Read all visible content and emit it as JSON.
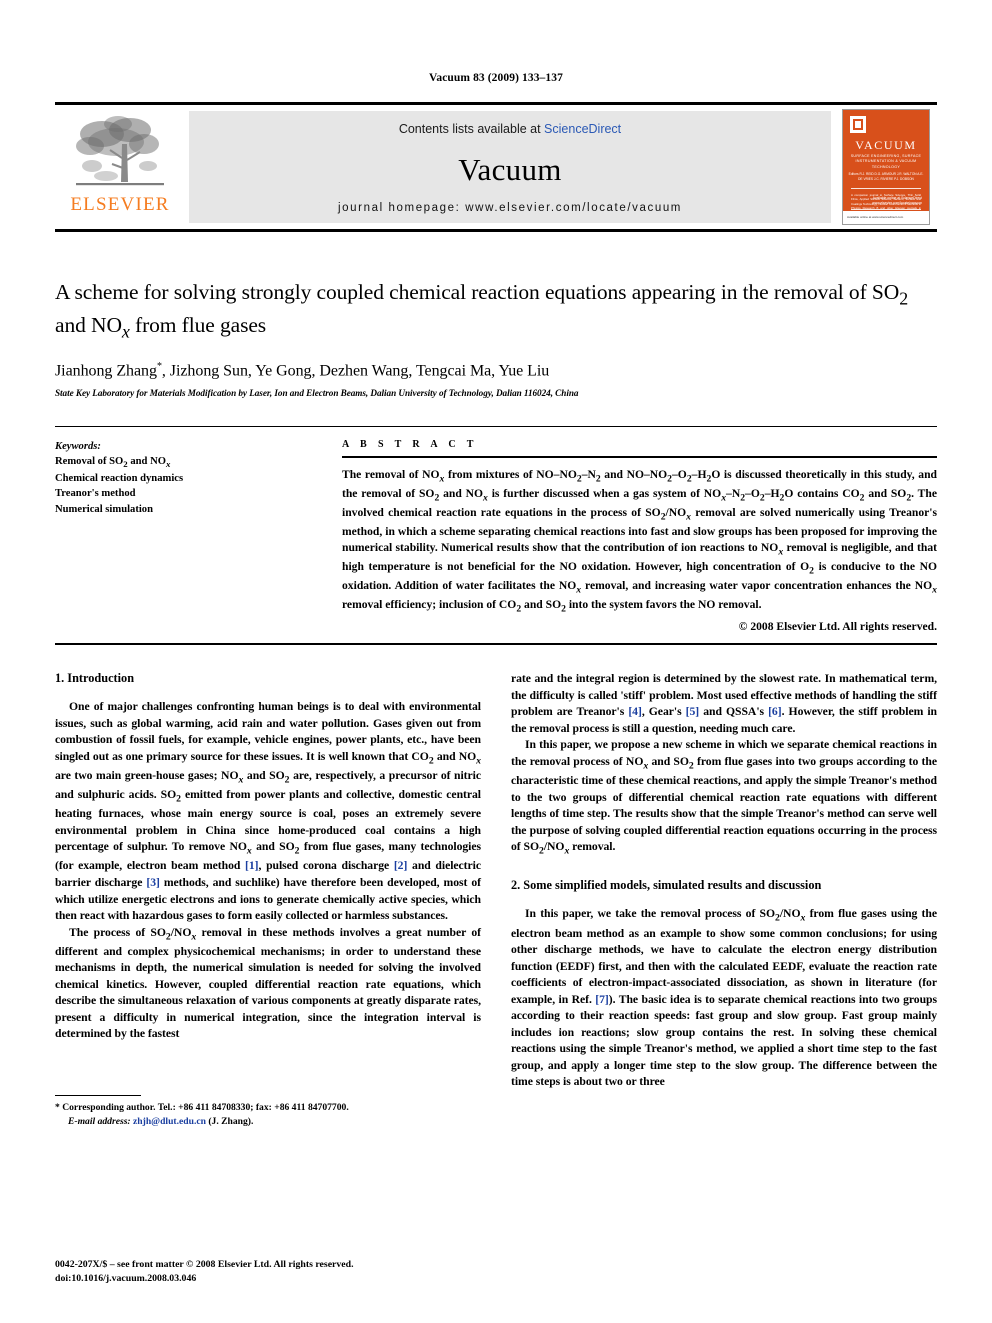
{
  "running_head": "Vacuum 83 (2009) 133–137",
  "masthead": {
    "contents_prefix": "Contents lists available at ",
    "sciencedirect": "ScienceDirect",
    "journal_name": "Vacuum",
    "homepage": "journal homepage: www.elsevier.com/locate/vacuum",
    "publisher_logo_text": "ELSEVIER",
    "accent_orange": "#F57C20",
    "sciencedirect_blue": "#2b59b5",
    "band_gray": "#e6e6e6"
  },
  "cover": {
    "title": "VACUUM",
    "subtitle": "SURFACE ENGINEERING, SURFACE INSTRUMENTATION & VACUUM TECHNOLOGY",
    "editors": "Editors\nR.J. REID   D.G. ARMOUR   J.R. WALTON\nA.E. DE VRIES   J.C. RIVIERE   P.J. DOBSON",
    "blurb": "A companion journal to Surface Science, Thin Solid Films, Applied Surface Science, Vacuum, Surface and Coatings Technology, Nuclear Instruments & Methods in Physics Research B and other Elsevier journals in materials science",
    "footer_left": "Available online at www.sciencedirect.com",
    "sciencedirect": "Available online at\nScienceDirect\nwww.elsevier.com/locate/vacuum",
    "cover_color": "#D8501B"
  },
  "article": {
    "title": "A scheme for solving strongly coupled chemical reaction equations appearing in the removal of SO₂ and NO𝑥 from flue gases",
    "title_line1_pre": "A scheme for solving strongly coupled chemical reaction equations",
    "authors": "Jianhong Zhang, Jizhong Sun, Ye Gong, Dezhen Wang, Tengcai Ma, Yue Liu",
    "corresponding_marker": "*",
    "affiliation": "State Key Laboratory for Materials Modification by Laser, Ion and Electron Beams, Dalian University of Technology, Dalian 116024, China"
  },
  "keywords": {
    "label": "Keywords:",
    "items": [
      "Removal of SO₂ and NO𝑥",
      "Chemical reaction dynamics",
      "Treanor's method",
      "Numerical simulation"
    ]
  },
  "abstract": {
    "label": "A B S T R A C T",
    "text": "The removal of NO𝑥 from mixtures of NO–NO₂–N₂ and NO–NO₂–O₂–H₂O is discussed theoretically in this study, and the removal of SO₂ and NO𝑥 is further discussed when a gas system of NO𝑥–N₂–O₂–H₂O contains CO₂ and SO₂. The involved chemical reaction rate equations in the process of SO₂/NO𝑥 removal are solved numerically using Treanor's method, in which a scheme separating chemical reactions into fast and slow groups has been proposed for improving the numerical stability. Numerical results show that the contribution of ion reactions to NO𝑥 removal is negligible, and that high temperature is not beneficial for the NO oxidation. However, high concentration of O₂ is conducive to the NO oxidation. Addition of water facilitates the NO𝑥 removal, and increasing water vapor concentration enhances the NO𝑥 removal efficiency; inclusion of CO₂ and SO₂ into the system favors the NO removal.",
    "copyright": "© 2008 Elsevier Ltd. All rights reserved."
  },
  "sections": {
    "intro_heading": "1. Introduction",
    "intro_p1": "One of major challenges confronting human beings is to deal with environmental issues, such as global warming, acid rain and water pollution. Gases given out from combustion of fossil fuels, for example, vehicle engines, power plants, etc., have been singled out as one primary source for these issues. It is well known that CO₂ and NO𝑥 are two main green-house gases; NO𝑥 and SO₂ are, respectively, a precursor of nitric and sulphuric acids. SO₂ emitted from power plants and collective, domestic central heating furnaces, whose main energy source is coal, poses an extremely severe environmental problem in China since home-produced coal contains a high percentage of sulphur. To remove NO𝑥 and SO₂ from flue gases, many technologies (for example, electron beam method [1], pulsed corona discharge [2] and dielectric barrier discharge [3] methods, and suchlike) have therefore been developed, most of which utilize energetic electrons and ions to generate chemically active species, which then react with hazardous gases to form easily collected or harmless substances.",
    "intro_p2": "The process of SO₂/NO𝑥 removal in these methods involves a great number of different and complex physicochemical mechanisms; in order to understand these mechanisms in depth, the numerical simulation is needed for solving the involved chemical kinetics. However, coupled differential reaction rate equations, which describe the simultaneous relaxation of various components at greatly disparate rates, present a difficulty in numerical integration, since the integration interval is determined by the fastest",
    "intro_p2_cont": "rate and the integral region is determined by the slowest rate. In mathematical term, the difficulty is called 'stiff' problem. Most used effective methods of handling the stiff problem are Treanor's [4], Gear's [5] and QSSA's [6]. However, the stiff problem in the removal process is still a question, needing much care.",
    "intro_p3": "In this paper, we propose a new scheme in which we separate chemical reactions in the removal process of NO𝑥 and SO₂ from flue gases into two groups according to the characteristic time of these chemical reactions, and apply the simple Treanor's method to the two groups of differential chemical reaction rate equations with different lengths of time step. The results show that the simple Treanor's method can serve well the purpose of solving coupled differential reaction equations occurring in the process of SO₂/NO𝑥 removal.",
    "sec2_heading": "2. Some simplified models, simulated results and discussion",
    "sec2_p1": "In this paper, we take the removal process of SO₂/NO𝑥 from flue gases using the electron beam method as an example to show some common conclusions; for using other discharge methods, we have to calculate the electron energy distribution function (EEDF) first, and then with the calculated EEDF, evaluate the reaction rate coefficients of electron-impact-associated dissociation, as shown in literature (for example, in Ref. [7]). The basic idea is to separate chemical reactions into two groups according to their reaction speeds: fast group and slow group. Fast group mainly includes ion reactions; slow group contains the rest. In solving these chemical reactions using the simple Treanor's method, we applied a short time step to the fast group, and apply a longer time step to the slow group. The difference between the time steps is about two or three"
  },
  "footnote": {
    "marker": "*",
    "line1": "Corresponding author. Tel.: +86 411 84708330; fax: +86 411 84707700.",
    "email_label": "E-mail address:",
    "email": "zhjh@dlut.edu.cn",
    "email_owner": "(J. Zhang)."
  },
  "page_footer": {
    "line1": "0042-207X/$ – see front matter © 2008 Elsevier Ltd. All rights reserved.",
    "line2": "doi:10.1016/j.vacuum.2008.03.046"
  }
}
